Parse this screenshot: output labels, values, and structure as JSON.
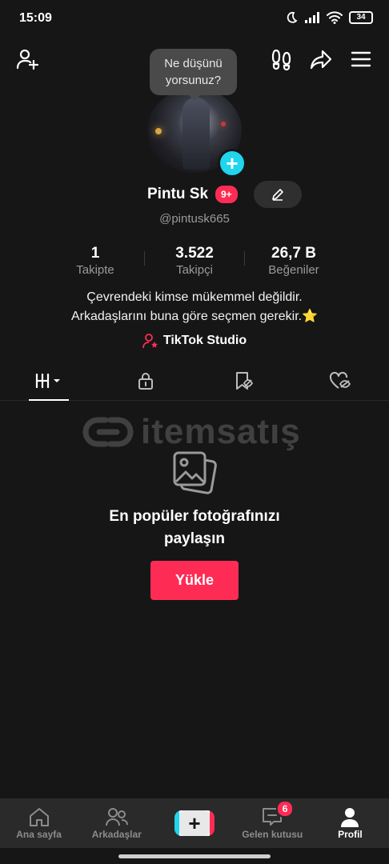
{
  "status": {
    "time": "15:09",
    "battery": "34"
  },
  "tooltip": {
    "line1": "Ne düşünü",
    "line2": "yorsunuz?"
  },
  "profile": {
    "name": "Pintu Sk",
    "badge": "9+",
    "username": "@pintusk665"
  },
  "stats": [
    {
      "num": "1",
      "label": "Takipte"
    },
    {
      "num": "3.522",
      "label": "Takipçi"
    },
    {
      "num": "26,7 B",
      "label": "Beğeniler"
    }
  ],
  "bio": {
    "line1": "Çevrendeki kimse mükemmel değildir.",
    "line2": "Arkadaşlarını buna göre seçmen gerekir.⭐"
  },
  "studio": {
    "label": "TikTok Studio"
  },
  "watermark": {
    "text": "itemsatış"
  },
  "empty": {
    "title_line1": "En popüler fotoğrafınızı",
    "title_line2": "paylaşın",
    "button": "Yükle"
  },
  "nav": {
    "home": "Ana sayfa",
    "friends": "Arkadaşlar",
    "create": "+",
    "inbox": "Gelen kutusu",
    "inbox_count": "6",
    "profile": "Profil"
  },
  "colors": {
    "accent": "#fe2c55",
    "cyan": "#20d5ec",
    "bg": "#161616"
  }
}
